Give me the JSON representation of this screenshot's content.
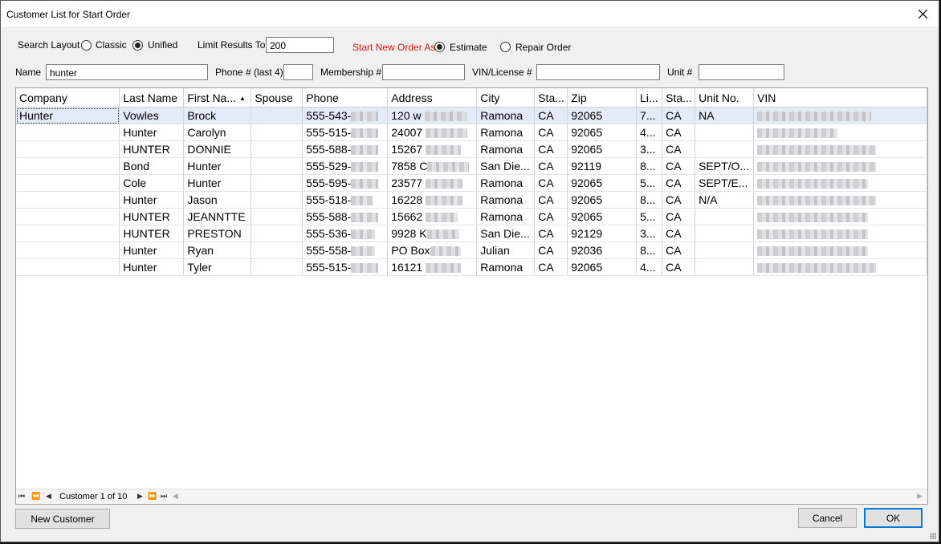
{
  "window": {
    "title": "Customer List for Start Order"
  },
  "search": {
    "layout_label": "Search Layout",
    "layout_options": [
      "Classic",
      "Unified"
    ],
    "limit_label": "Limit Results To",
    "limit_value": "200",
    "start_order_label": "Start New Order As:",
    "start_order_options": [
      "Estimate",
      "Repair Order"
    ],
    "name_label": "Name",
    "name_value": "hunter",
    "phone_label": "Phone # (last 4)",
    "membership_label": "Membership #",
    "vin_label": "VIN/License #",
    "unit_label": "Unit #"
  },
  "grid": {
    "columns": [
      "Company",
      "Last Name",
      "First Na...",
      "Spouse",
      "Phone",
      "Address",
      "City",
      "Sta...",
      "Zip",
      "Li...",
      "Sta...",
      "Unit No.",
      "VIN"
    ],
    "rows": [
      {
        "company": "Hunter",
        "last": "Vowles",
        "first": "Brock",
        "phone": "555-543-",
        "address": "120 w",
        "city": "Ramona",
        "state": "CA",
        "zip": "92065",
        "li": "7...",
        "st2": "CA",
        "unit": "NA"
      },
      {
        "company": "",
        "last": "Hunter",
        "first": "Carolyn",
        "phone": "555-515-",
        "address": "24007",
        "city": "Ramona",
        "state": "CA",
        "zip": "92065",
        "li": "4...",
        "st2": "CA",
        "unit": ""
      },
      {
        "company": "",
        "last": "HUNTER",
        "first": "DONNIE",
        "phone": "555-588-",
        "address": "15267",
        "city": "Ramona",
        "state": "CA",
        "zip": "92065",
        "li": "3...",
        "st2": "CA",
        "unit": ""
      },
      {
        "company": "",
        "last": "Bond",
        "first": "Hunter",
        "phone": "555-529-",
        "address": "7858 C",
        "city": "San Die...",
        "state": "CA",
        "zip": "92119",
        "li": "8...",
        "st2": "CA",
        "unit": "SEPT/O..."
      },
      {
        "company": "",
        "last": "Cole",
        "first": "Hunter",
        "phone": "555-595-",
        "address": "23577",
        "city": "Ramona",
        "state": "CA",
        "zip": "92065",
        "li": "5...",
        "st2": "CA",
        "unit": "SEPT/E..."
      },
      {
        "company": "",
        "last": "Hunter",
        "first": "Jason",
        "phone": "555-518-",
        "address": "16228",
        "city": "Ramona",
        "state": "CA",
        "zip": "92065",
        "li": "8...",
        "st2": "CA",
        "unit": "N/A"
      },
      {
        "company": "",
        "last": "HUNTER",
        "first": "JEANNTTE",
        "phone": "555-588-",
        "address": "15662",
        "city": "Ramona",
        "state": "CA",
        "zip": "92065",
        "li": "5...",
        "st2": "CA",
        "unit": ""
      },
      {
        "company": "",
        "last": "HUNTER",
        "first": "PRESTON",
        "phone": "555-536-",
        "address": "9928 K",
        "city": "San Die...",
        "state": "CA",
        "zip": "92129",
        "li": "3...",
        "st2": "CA",
        "unit": ""
      },
      {
        "company": "",
        "last": "Hunter",
        "first": "Ryan",
        "phone": "555-558-",
        "address": "PO Box",
        "city": "Julian",
        "state": "CA",
        "zip": "92036",
        "li": "8...",
        "st2": "CA",
        "unit": ""
      },
      {
        "company": "",
        "last": "Hunter",
        "first": "Tyler",
        "phone": "555-515-",
        "address": "16121",
        "city": "Ramona",
        "state": "CA",
        "zip": "92065",
        "li": "4...",
        "st2": "CA",
        "unit": ""
      }
    ],
    "navigator_text": "Customer 1 of 10"
  },
  "buttons": {
    "new_customer": "New Customer",
    "cancel": "Cancel",
    "ok": "OK"
  },
  "colors": {
    "selected_row": "#e3ebf8",
    "required_label": "#e01010",
    "default_button_border": "#0078d7"
  }
}
